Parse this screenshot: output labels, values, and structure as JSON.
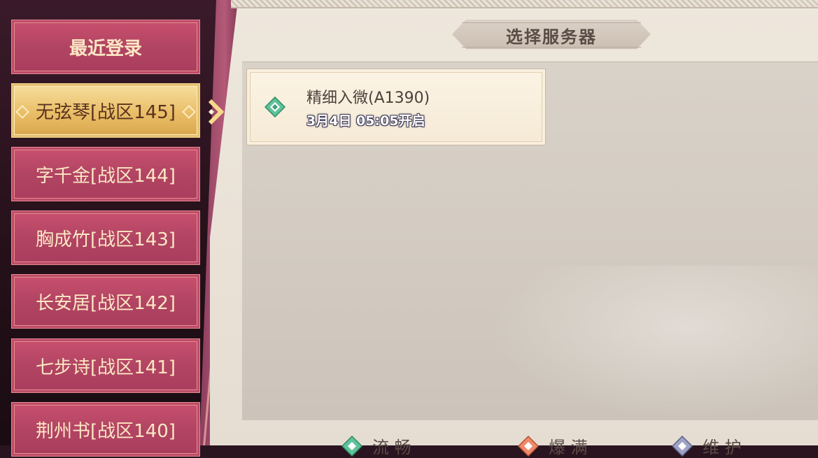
{
  "panel": {
    "title": "选择服务器"
  },
  "menu": {
    "items": [
      {
        "label": "最近登录"
      },
      {
        "label": "无弦琴[战区145]"
      },
      {
        "label": "字千金[战区144]"
      },
      {
        "label": "胸成竹[战区143]"
      },
      {
        "label": "长安居[战区142]"
      },
      {
        "label": "七步诗[战区141]"
      },
      {
        "label": "荆州书[战区140]"
      }
    ],
    "active_index": 1
  },
  "servers": [
    {
      "name": "精细入微(A1390)",
      "open_time": "3月4日 05:05开启",
      "status": "smooth"
    }
  ],
  "legend": [
    {
      "label": "流 畅",
      "color": "#3fa67a"
    },
    {
      "label": "爆 满",
      "color": "#d9684a"
    },
    {
      "label": "维 护",
      "color": "#7a7fa6"
    }
  ],
  "icons": {
    "server_status": "diamond-icon",
    "selected_arrow": "chevron-right-icon"
  }
}
